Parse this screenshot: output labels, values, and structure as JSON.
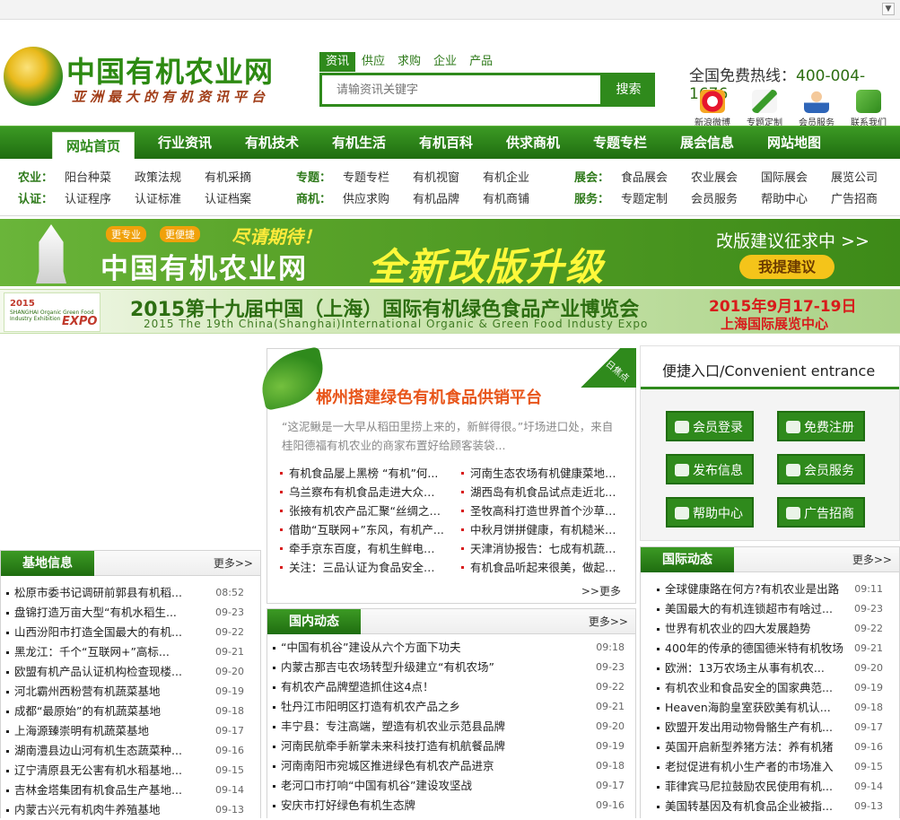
{
  "header": {
    "site_title": "中国有机农业网",
    "site_slogan": "亚洲最大的有机资讯平台",
    "search_tabs": [
      "资讯",
      "供应",
      "求购",
      "企业",
      "产品"
    ],
    "search_placeholder": "请输资讯关键字",
    "search_button": "搜索",
    "hotline_label": "全国免费热线：",
    "hotline_number": "400-004-1676",
    "quick_icons": [
      {
        "label": "新浪微博",
        "icon": "weibo-icon"
      },
      {
        "label": "专题定制",
        "icon": "pencil-icon"
      },
      {
        "label": "会员服务",
        "icon": "user-icon"
      },
      {
        "label": "联系我们",
        "icon": "phone-icon"
      }
    ]
  },
  "nav": [
    "网站首页",
    "行业资讯",
    "有机技术",
    "有机生活",
    "有机百科",
    "供求商机",
    "专题专栏",
    "展会信息",
    "网站地图"
  ],
  "subnav": {
    "row1": [
      {
        "label": "农业：",
        "items": [
          "阳台种菜",
          "政策法规",
          "有机采摘"
        ]
      },
      {
        "label": "专题：",
        "items": [
          "专题专栏",
          "有机视窗",
          "有机企业"
        ]
      },
      {
        "label": "展会：",
        "items": [
          "食品展会",
          "农业展会",
          "国际展会",
          "展览公司"
        ]
      }
    ],
    "row2": [
      {
        "label": "认证：",
        "items": [
          "认证程序",
          "认证标准",
          "认证档案"
        ]
      },
      {
        "label": "商机：",
        "items": [
          "供应求购",
          "有机品牌",
          "有机商铺"
        ]
      },
      {
        "label": "服务：",
        "items": [
          "专题定制",
          "会员服务",
          "帮助中心",
          "广告招商"
        ]
      }
    ]
  },
  "banner1": {
    "tag1": "更专业",
    "tag2": "更便捷",
    "expect": "尽请期待！",
    "main": "中国有机农业网",
    "big": "全新改版升级",
    "right": "改版建议征求中 >>",
    "button": "我提建议"
  },
  "banner2": {
    "logo_year": "2015",
    "logo_sub": "SHANGHAI Organic Green Food Industry Exhibition",
    "logo_expo": "EXPO",
    "title": "2015第十九届中国（上海）国际有机绿色食品产业博览会",
    "title_en": "2015 The 19th China(Shanghai)International Organic & Green Food Industy Expo",
    "date": "2015年9月17-19日",
    "location": "上海国际展览中心"
  },
  "featured": {
    "tag": "今日焦点",
    "headline": "郴州搭建绿色有机食品供销平台",
    "summary": "“这泥鳅是一大早从稻田里捞上来的，新鲜得很。”圩场进口处，来自桂阳德福有机农业的商家布置好给顾客装袋...",
    "left": [
      "有机食品屡上黑榜 “有机”何...",
      "乌兰察布有机食品走进大众市民...",
      "张掖有机农产品汇聚“丝绸之路...",
      "借助“互联网+”东风，有机产...",
      "牵手京东百度，有机生鲜电商论...",
      "关注：三品认证为食品安全保驾..."
    ],
    "right": [
      "河南生态农场有机健康菜地免费",
      "湖西岛有机食品试点走近北京5.",
      "圣牧高科打造世界首个沙草有机",
      "中秋月饼拼健康，有机糙米做饼",
      "天津消协报告：七成有机蔬菜样",
      "有机食品听起来很美，做起来很"
    ],
    "more": ">>更多"
  },
  "quick_entry": {
    "title": "便捷入口/Convenient entrance",
    "buttons": [
      {
        "label": "会员登录",
        "icon": "users-icon"
      },
      {
        "label": "免费注册",
        "icon": "camera-icon"
      },
      {
        "label": "发布信息",
        "icon": "doc-icon"
      },
      {
        "label": "会员服务",
        "icon": "mail-icon"
      },
      {
        "label": "帮助中心",
        "icon": "help-icon"
      },
      {
        "label": "广告招商",
        "icon": "yen-icon"
      }
    ]
  },
  "base_info": {
    "title": "基地信息",
    "more": "更多>>",
    "items": [
      {
        "t": "松原市委书记调研前郭县有机稻...",
        "d": "08:52"
      },
      {
        "t": "盘锦打造万亩大型“有机水稻生...",
        "d": "09-23"
      },
      {
        "t": "山西汾阳市打造全国最大的有机...",
        "d": "09-22"
      },
      {
        "t": "黑龙江：千个“互联网+”高标...",
        "d": "09-21"
      },
      {
        "t": "欧盟有机产品认证机构检查现楼...",
        "d": "09-20"
      },
      {
        "t": "河北霸州西粉营有机蔬菜基地",
        "d": "09-19"
      },
      {
        "t": "成都“最原始”的有机蔬菜基地",
        "d": "09-18"
      },
      {
        "t": "上海源臻崇明有机蔬菜基地",
        "d": "09-17"
      },
      {
        "t": "湖南澧县边山河有机生态蔬菜种...",
        "d": "09-16"
      },
      {
        "t": "辽宁清原县无公害有机水稻基地...",
        "d": "09-15"
      },
      {
        "t": "吉林金塔集团有机食品生产基地...",
        "d": "09-14"
      },
      {
        "t": "内蒙古兴元有机肉牛养殖基地",
        "d": "09-13"
      }
    ]
  },
  "domestic": {
    "title": "国内动态",
    "more": "更多>>",
    "items": [
      {
        "t": "“中国有机谷”建设从六个方面下功夫",
        "d": "09:18"
      },
      {
        "t": "内蒙古那吉屯农场转型升级建立“有机农场”",
        "d": "09-23"
      },
      {
        "t": "有机农产品牌塑造抓住这4点！",
        "d": "09-22"
      },
      {
        "t": "牡丹江市阳明区打造有机农产品之乡",
        "d": "09-21"
      },
      {
        "t": "丰宁县：专注高端，塑造有机农业示范县品牌",
        "d": "09-20"
      },
      {
        "t": "河南民航牵手新掌未来科技打造有机航餐品牌",
        "d": "09-19"
      },
      {
        "t": "河南南阳市宛城区推进绿色有机农产品进京",
        "d": "09-18"
      },
      {
        "t": "老河口市打响“中国有机谷”建设攻坚战",
        "d": "09-17"
      },
      {
        "t": "安庆市打好绿色有机生态牌",
        "d": "09-16"
      }
    ]
  },
  "international": {
    "title": "国际动态",
    "more": "更多>>",
    "items": [
      {
        "t": "全球健康路在何方?有机农业是出路",
        "d": "09:11"
      },
      {
        "t": "美国最大的有机连锁超市有啥过...",
        "d": "09-23"
      },
      {
        "t": "世界有机农业的四大发展趋势",
        "d": "09-22"
      },
      {
        "t": "400年的传承的德国德米特有机牧场",
        "d": "09-21"
      },
      {
        "t": "欧洲：13万农场主从事有机农...",
        "d": "09-20"
      },
      {
        "t": "有机农业和食品安全的国家典范...",
        "d": "09-19"
      },
      {
        "t": "Heaven海韵皇室获欧美有机认...",
        "d": "09-18"
      },
      {
        "t": "欧盟开发出用动物骨骼生产有机...",
        "d": "09-17"
      },
      {
        "t": "英国开启新型养猪方法：养有机猪",
        "d": "09-16"
      },
      {
        "t": "老挝促进有机小生产者的市场准入",
        "d": "09-15"
      },
      {
        "t": "菲律宾马尼拉鼓励农民使用有机...",
        "d": "09-14"
      },
      {
        "t": "美国转基因及有机食品企业被指...",
        "d": "09-13"
      }
    ]
  }
}
